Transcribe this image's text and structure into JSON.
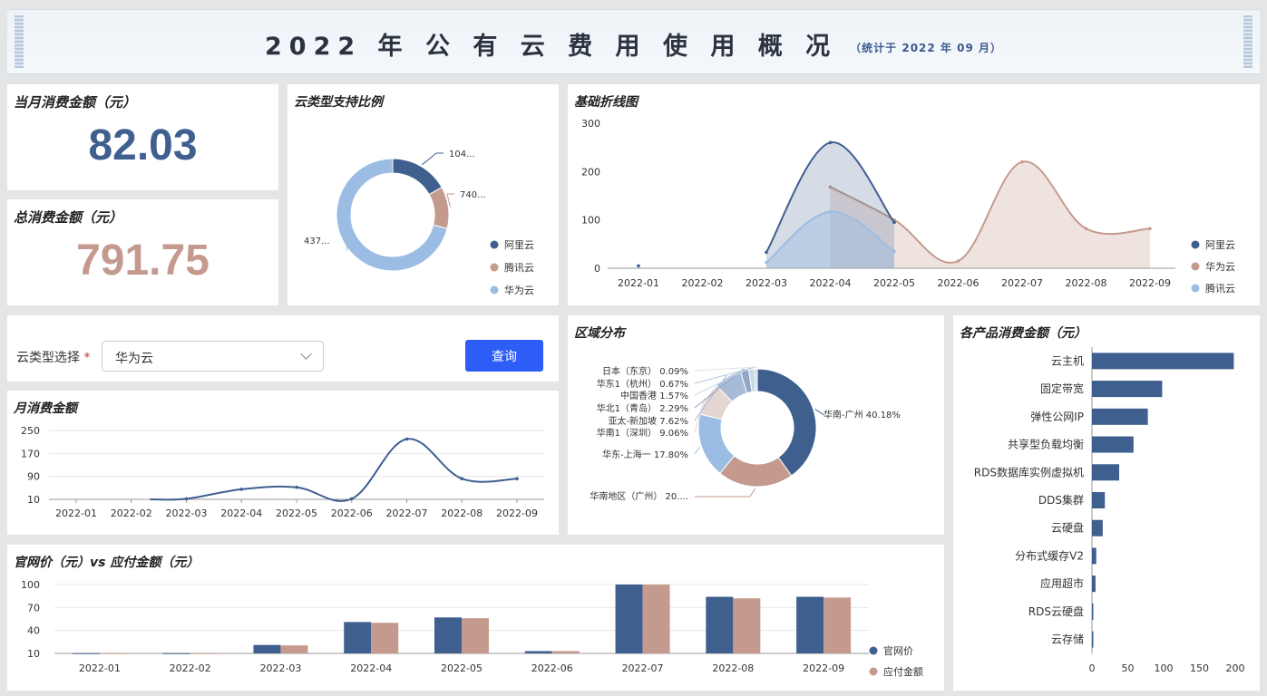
{
  "header": {
    "title": "2022 年 公 有 云 费 用 使 用 概 况",
    "subtitle": "（统计于 2022 年 09 月）"
  },
  "kpi": {
    "month_label": "当月消费金额（元）",
    "month_value": "82.03",
    "month_color": "#3f5f8f",
    "total_label": "总消费金额（元）",
    "total_value": "791.75",
    "total_color": "#c49a8e"
  },
  "colors": {
    "aliyun": "#3f5f8f",
    "tencent": "#c49a8e",
    "huawei": "#9cbde3"
  },
  "filter": {
    "label": "云类型选择",
    "required_mark": "*",
    "selected": "华为云",
    "query_label": "查询"
  },
  "chart_data": [
    {
      "id": "cloud-ratio",
      "type": "pie",
      "title": "云类型支持比例",
      "slices": [
        {
          "name": "阿里云",
          "value": 104,
          "label": "104...",
          "color": "#3f5f8f"
        },
        {
          "name": "腾讯云",
          "value": 74,
          "label": "740...",
          "color": "#c49a8e"
        },
        {
          "name": "华为云",
          "value": 437,
          "label": "437...",
          "color": "#9cbde3"
        }
      ]
    },
    {
      "id": "basic-line",
      "type": "line",
      "title": "基础折线图",
      "x": [
        "2022-01",
        "2022-02",
        "2022-03",
        "2022-04",
        "2022-05",
        "2022-06",
        "2022-07",
        "2022-08",
        "2022-09"
      ],
      "ylim": [
        0,
        300
      ],
      "yticks": [
        0,
        100,
        200,
        300
      ],
      "series": [
        {
          "name": "阿里云",
          "color": "#3f5f8f",
          "values": [
            5,
            null,
            33,
            260,
            95,
            null,
            null,
            null,
            null
          ]
        },
        {
          "name": "华为云",
          "color": "#c49a8e",
          "values": [
            null,
            null,
            null,
            168,
            100,
            15,
            220,
            82,
            82
          ]
        },
        {
          "name": "腾讯云",
          "color": "#9cbde3",
          "values": [
            null,
            null,
            12,
            117,
            35,
            null,
            null,
            null,
            null
          ]
        }
      ]
    },
    {
      "id": "monthly",
      "type": "line",
      "title": "月消费金额",
      "x": [
        "2022-01",
        "2022-02",
        "2022-03",
        "2022-04",
        "2022-05",
        "2022-06",
        "2022-07",
        "2022-08",
        "2022-09"
      ],
      "ylim": [
        10,
        250
      ],
      "yticks": [
        10,
        90,
        170,
        250
      ],
      "series": [
        {
          "name": "华为云",
          "color": "#3f5f8f",
          "values": [
            null,
            null,
            12,
            45,
            52,
            12,
            220,
            82,
            82
          ]
        }
      ]
    },
    {
      "id": "region",
      "type": "pie",
      "title": "区域分布",
      "slices": [
        {
          "name": "华南-广州",
          "value": 40.18,
          "label": "华南-广州 40.18%",
          "color": "#3f5f8f"
        },
        {
          "name": "华南地区（广州）",
          "value": 20.79,
          "label": "华南地区（广州） 20....",
          "color": "#c49a8e"
        },
        {
          "name": "华东-上海一",
          "value": 17.8,
          "label": "华东-上海一 17.80%",
          "color": "#9cbde3"
        },
        {
          "name": "华南1（深圳）",
          "value": 9.06,
          "label": "华南1（深圳） 9.06%",
          "color": "#e6d6d1"
        },
        {
          "name": "亚太-新加坡",
          "value": 7.62,
          "label": "亚太-新加坡 7.62%",
          "color": "#a6bcd6"
        },
        {
          "name": "华北1（青岛）",
          "value": 2.29,
          "label": "华北1（青岛） 2.29%",
          "color": "#8fa6c4"
        },
        {
          "name": "中国香港",
          "value": 1.57,
          "label": "中国香港 1.57%",
          "color": "#c8d8ea"
        },
        {
          "name": "华东1（杭州）",
          "value": 0.67,
          "label": "华东1（杭州） 0.67%",
          "color": "#b4c7df"
        },
        {
          "name": "日本（东京）",
          "value": 0.09,
          "label": "日本（东京） 0.09%",
          "color": "#dde5ef"
        }
      ]
    },
    {
      "id": "products",
      "type": "bar",
      "orientation": "horizontal",
      "title": "各产品消费金额（元）",
      "categories": [
        "云主机",
        "固定带宽",
        "弹性公网IP",
        "共享型负载均衡",
        "RDS数据库实例虚拟机",
        "DDS集群",
        "云硬盘",
        "分布式缓存V2",
        "应用超市",
        "RDS云硬盘",
        "云存储"
      ],
      "values": [
        198,
        98,
        78,
        58,
        38,
        18,
        15,
        6,
        5,
        1.5,
        1
      ],
      "xlim": [
        0,
        200
      ],
      "xticks": [
        0,
        50,
        100,
        150,
        200
      ],
      "color": "#3f5f8f"
    },
    {
      "id": "price-compare",
      "type": "bar",
      "title": "官网价（元）vs 应付金额（元）",
      "categories": [
        "2022-01",
        "2022-02",
        "2022-03",
        "2022-04",
        "2022-05",
        "2022-06",
        "2022-07",
        "2022-08",
        "2022-09"
      ],
      "ylim": [
        10,
        100
      ],
      "yticks": [
        10,
        40,
        70,
        100
      ],
      "series": [
        {
          "name": "官网价",
          "color": "#3f5f8f",
          "values": [
            10.3,
            10.3,
            21,
            51,
            57,
            13,
            100,
            84,
            84
          ]
        },
        {
          "name": "应付金额",
          "color": "#c49a8e",
          "values": [
            10.3,
            10.3,
            20.5,
            50,
            56,
            13,
            100,
            82,
            83
          ]
        }
      ]
    }
  ]
}
